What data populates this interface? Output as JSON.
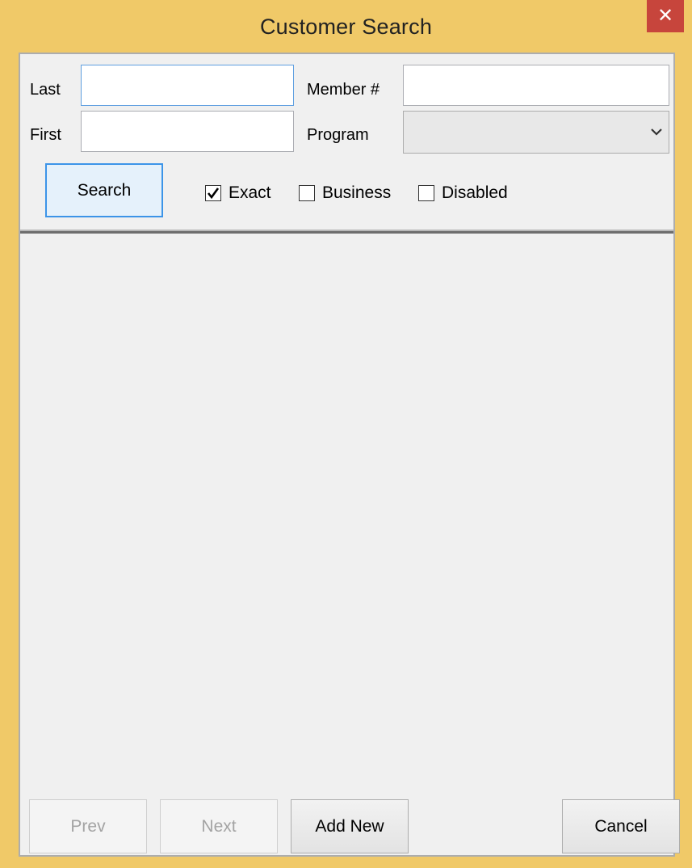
{
  "window": {
    "title": "Customer Search",
    "close_glyph": "✕",
    "accent_color": "#f0c968",
    "close_color": "#c7453c"
  },
  "form": {
    "last_label": "Last",
    "last_value": "",
    "first_label": "First",
    "first_value": "",
    "member_label": "Member #",
    "member_value": "",
    "program_label": "Program",
    "program_value": "",
    "search_button": "Search",
    "checkboxes": [
      {
        "label": "Exact",
        "checked": true
      },
      {
        "label": "Business",
        "checked": false
      },
      {
        "label": "Disabled",
        "checked": false
      }
    ]
  },
  "footer": {
    "prev_button": "Prev",
    "next_button": "Next",
    "add_new_button": "Add New",
    "cancel_button": "Cancel"
  },
  "icons": {
    "close": "close-icon",
    "dropdown": "chevron-down-icon",
    "check": "checkmark-icon"
  }
}
